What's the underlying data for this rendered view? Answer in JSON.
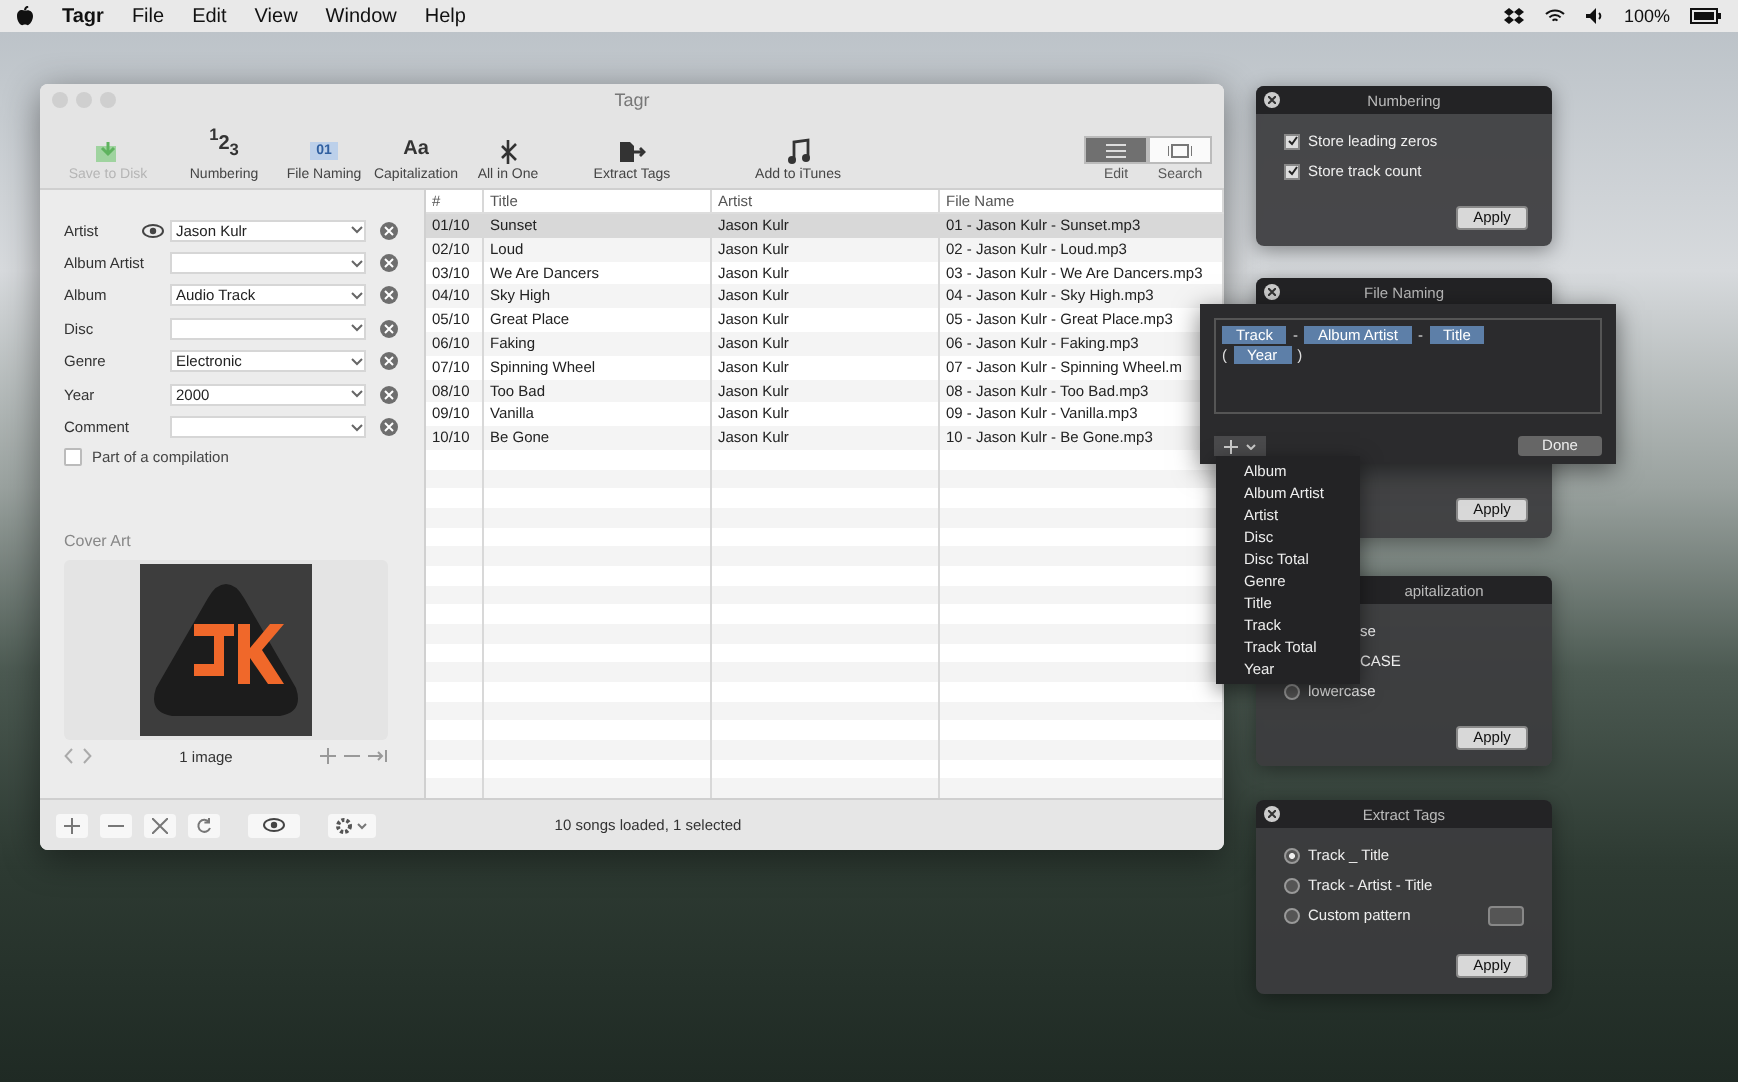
{
  "menubar": {
    "app": "Tagr",
    "menus": [
      "File",
      "Edit",
      "View",
      "Window",
      "Help"
    ],
    "battery": "100%"
  },
  "main_window": {
    "title": "Tagr",
    "toolbar": [
      {
        "kind": "save",
        "label": "Save to Disk",
        "disabled": true
      },
      {
        "kind": "numbering",
        "glyph": "$^{1}$2$_{3}$",
        "label": "Numbering",
        "disabled": false
      },
      {
        "kind": "naming",
        "glyph": "01",
        "label": "File Naming",
        "disabled": false
      },
      {
        "kind": "caps",
        "glyph": "Aa",
        "label": "Capitalization",
        "disabled": false
      },
      {
        "kind": "allinone",
        "label": "All in One",
        "disabled": false
      },
      {
        "kind": "extract",
        "label": "Extract Tags",
        "disabled": false
      },
      {
        "kind": "itunes",
        "label": "Add to iTunes",
        "disabled": false
      }
    ],
    "view_modes": [
      {
        "label": "Edit",
        "selected": true
      },
      {
        "label": "Search",
        "selected": false
      }
    ],
    "fields": [
      {
        "kind": "toggleable",
        "label": "Artist",
        "value": "Jason Kulr"
      },
      {
        "kind": "plain",
        "label": "Album Artist"
      },
      {
        "kind": "plain",
        "label": "Album",
        "value": "Audio Track"
      },
      {
        "kind": "plain",
        "label": "Disc"
      },
      {
        "kind": "plain",
        "label": "Genre",
        "value": "Electronic"
      },
      {
        "kind": "plain",
        "label": "Year",
        "value": "2000"
      },
      {
        "kind": "plain",
        "label": "Comment"
      }
    ],
    "compilation": {
      "label": "Part of a compilation",
      "checked": false
    },
    "cover_art": {
      "title": "Cover Art",
      "count": "1 image"
    },
    "table": {
      "columns": [
        "#",
        "Title",
        "Artist",
        "File Name"
      ],
      "rows": [
        {
          "cells": [
            "01/10",
            "Sunset",
            "Jason Kulr",
            "01 - Jason Kulr - Sunset.mp3"
          ],
          "selected": true
        },
        {
          "cells": [
            "02/10",
            "Loud",
            "Jason Kulr",
            "02 - Jason Kulr - Loud.mp3"
          ],
          "selected": false
        },
        {
          "cells": [
            "03/10",
            "We Are Dancers",
            "Jason Kulr",
            "03 - Jason Kulr - We Are Dancers.mp3"
          ],
          "selected": false
        },
        {
          "cells": [
            "04/10",
            "Sky High",
            "Jason Kulr",
            "04 - Jason Kulr - Sky High.mp3"
          ],
          "selected": false
        },
        {
          "cells": [
            "05/10",
            "Great Place",
            "Jason Kulr",
            "05 - Jason Kulr - Great Place.mp3"
          ],
          "selected": false
        },
        {
          "cells": [
            "06/10",
            "Faking",
            "Jason Kulr",
            "06 - Jason Kulr - Faking.mp3"
          ],
          "selected": false
        },
        {
          "cells": [
            "07/10",
            "Spinning Wheel",
            "Jason Kulr",
            "07 - Jason Kulr - Spinning Wheel.m"
          ],
          "selected": false
        },
        {
          "cells": [
            "08/10",
            "Too Bad",
            "Jason Kulr",
            "08 - Jason Kulr - Too Bad.mp3"
          ],
          "selected": false
        },
        {
          "cells": [
            "09/10",
            "Vanilla",
            "Jason Kulr",
            "09 - Jason Kulr - Vanilla.mp3"
          ],
          "selected": false
        },
        {
          "cells": [
            "10/10",
            "Be Gone",
            "Jason Kulr",
            "10 - Jason Kulr - Be Gone.mp3"
          ],
          "selected": false
        }
      ]
    },
    "status": "10 songs loaded, 1 selected"
  },
  "numbering_panel": {
    "title": "Numbering",
    "options": [
      {
        "label": "Store leading zeros",
        "checked": true
      },
      {
        "label": "Store track count",
        "checked": true
      }
    ],
    "apply": "Apply"
  },
  "file_naming_panel": {
    "title": "File Naming",
    "apply": "Apply",
    "editor": {
      "lines": [
        [
          {
            "kind": "token",
            "text": "Track"
          },
          {
            "kind": "sep",
            "text": "-"
          },
          {
            "kind": "token",
            "text": "Album Artist"
          },
          {
            "kind": "sep",
            "text": "-"
          },
          {
            "kind": "token",
            "text": "Title"
          }
        ],
        [
          {
            "kind": "sep",
            "text": "("
          },
          {
            "kind": "token",
            "text": "Year"
          },
          {
            "kind": "sep",
            "text": ")"
          }
        ]
      ],
      "done": "Done",
      "menu": [
        "Album",
        "Album Artist",
        "Artist",
        "Disc",
        "Disc Total",
        "Genre",
        "Title",
        "Track",
        "Track Total",
        "Year"
      ]
    }
  },
  "capitalization_panel": {
    "title": "apitalization",
    "options": [
      {
        "kind": "partial",
        "label": "se"
      },
      {
        "kind": "partial",
        "label": "CASE"
      },
      {
        "kind": "radio",
        "label": "lowercase",
        "selected": false
      }
    ],
    "apply": "Apply"
  },
  "extract_tags_panel": {
    "title": "Extract Tags",
    "options": [
      {
        "label": "Track _ Title",
        "selected": true
      },
      {
        "label": "Track - Artist - Title",
        "selected": false
      },
      {
        "label": "Custom pattern",
        "selected": false
      }
    ],
    "apply": "Apply"
  }
}
